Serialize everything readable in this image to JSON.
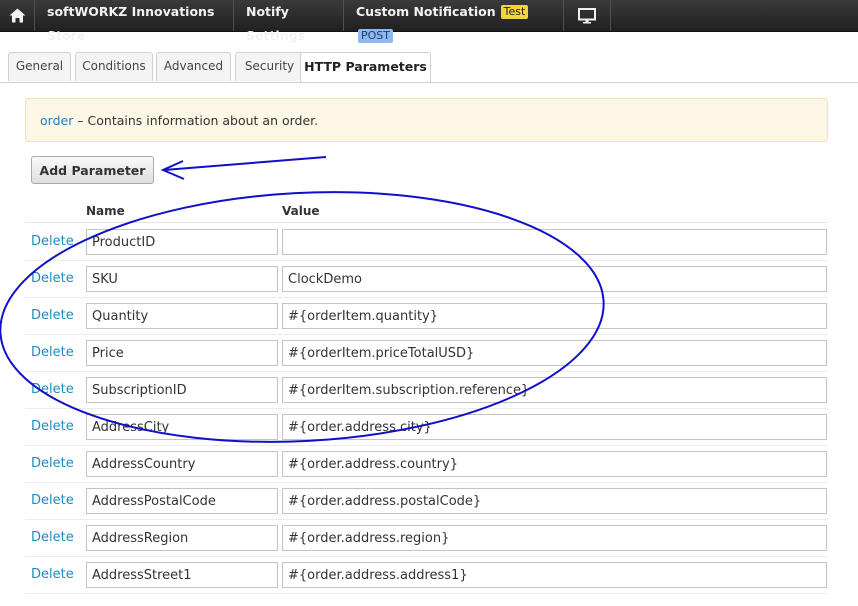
{
  "topbar": {
    "crumbs": [
      "softWORKZ Innovations Store",
      "Notify Settings",
      "Custom Notification"
    ],
    "badges": [
      "Test",
      "POST"
    ]
  },
  "tabs": [
    "General",
    "Conditions",
    "Advanced",
    "Security",
    "HTTP Parameters"
  ],
  "info": {
    "link": "order",
    "text": " – Contains information about an order."
  },
  "add_button": "Add Parameter",
  "columns": {
    "name": "Name",
    "value": "Value"
  },
  "delete_label": "Delete",
  "params": [
    {
      "name": "ProductID",
      "value": ""
    },
    {
      "name": "SKU",
      "value": "ClockDemo"
    },
    {
      "name": "Quantity",
      "value": "#{orderItem.quantity}"
    },
    {
      "name": "Price",
      "value": "#{orderItem.priceTotalUSD}"
    },
    {
      "name": "SubscriptionID",
      "value": "#{orderItem.subscription.reference}"
    },
    {
      "name": "AddressCity",
      "value": "#{order.address.city}"
    },
    {
      "name": "AddressCountry",
      "value": "#{order.address.country}"
    },
    {
      "name": "AddressPostalCode",
      "value": "#{order.address.postalCode}"
    },
    {
      "name": "AddressRegion",
      "value": "#{order.address.region}"
    },
    {
      "name": "AddressStreet1",
      "value": "#{order.address.address1}"
    }
  ],
  "colors": {
    "annotation": "#1010c8",
    "link": "#1e8bc3"
  }
}
